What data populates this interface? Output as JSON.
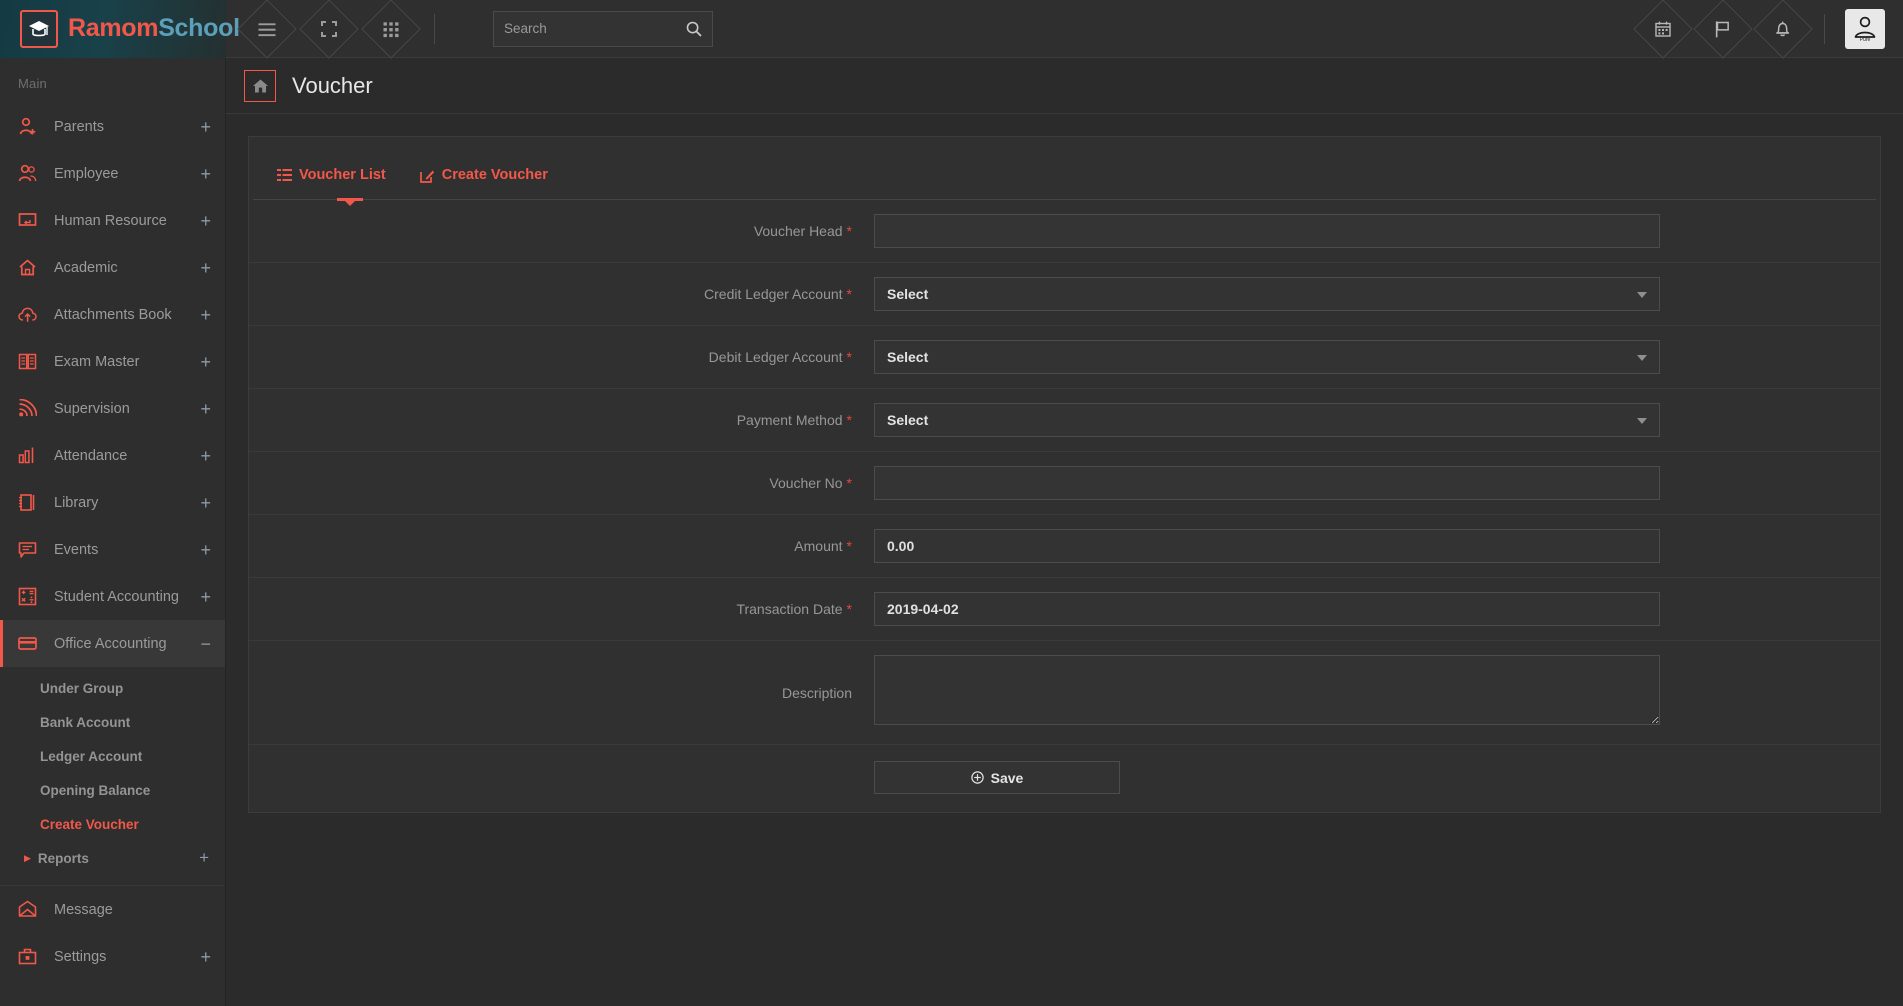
{
  "brand": {
    "name_part1": "Ramom",
    "name_part2": "School",
    "logo_icon": "graduation-cap-icon"
  },
  "topbar": {
    "menu_toggle_icon": "hamburger-menu-icon",
    "fullscreen_icon": "fullscreen-icon",
    "grid_icon": "grid-apps-icon",
    "calendar_icon": "calendar-icon",
    "flag_icon": "flag-icon",
    "bell_icon": "bell-notification-icon",
    "avatar_icon": "user-avatar-icon",
    "avatar_label": "Pure"
  },
  "search": {
    "value": "",
    "placeholder": "Search",
    "icon": "search-icon"
  },
  "sidebar": {
    "heading": "Main",
    "items": [
      {
        "label": "Parents",
        "icon": "user-add-icon",
        "expander": "+"
      },
      {
        "label": "Employee",
        "icon": "users-icon",
        "expander": "+"
      },
      {
        "label": "Human Resource",
        "icon": "monitor-icon",
        "expander": "+"
      },
      {
        "label": "Academic",
        "icon": "home-academic-icon",
        "expander": "+"
      },
      {
        "label": "Attachments Book",
        "icon": "cloud-upload-icon",
        "expander": "+"
      },
      {
        "label": "Exam Master",
        "icon": "open-book-icon",
        "expander": "+"
      },
      {
        "label": "Supervision",
        "icon": "rss-signal-icon",
        "expander": "+"
      },
      {
        "label": "Attendance",
        "icon": "bar-chart-icon",
        "expander": "+"
      },
      {
        "label": "Library",
        "icon": "book-icon",
        "expander": "+"
      },
      {
        "label": "Events",
        "icon": "chat-bubble-icon",
        "expander": "+"
      },
      {
        "label": "Student Accounting",
        "icon": "calculator-icon",
        "expander": "+"
      },
      {
        "label": "Office Accounting",
        "icon": "credit-card-icon",
        "expander": "−",
        "active": true
      }
    ],
    "submenu": [
      {
        "label": "Under Group"
      },
      {
        "label": "Bank Account"
      },
      {
        "label": "Ledger Account"
      },
      {
        "label": "Opening Balance"
      },
      {
        "label": "Create Voucher",
        "active": true
      },
      {
        "label": "Reports",
        "caret": "▶",
        "expander": "+"
      }
    ],
    "bottom_items": [
      {
        "label": "Message",
        "icon": "envelope-icon",
        "expander": ""
      },
      {
        "label": "Settings",
        "icon": "toolbox-icon",
        "expander": "+"
      }
    ]
  },
  "page": {
    "title": "Voucher",
    "home_icon": "home-icon"
  },
  "tabs": [
    {
      "label": "Voucher List",
      "icon": "list-icon",
      "active": false
    },
    {
      "label": "Create Voucher",
      "icon": "pencil-edit-icon",
      "active": true
    }
  ],
  "form": {
    "fields": [
      {
        "label": "Voucher Head",
        "required": true,
        "type": "text",
        "value": "",
        "placeholder": ""
      },
      {
        "label": "Credit Ledger Account",
        "required": true,
        "type": "select",
        "value": "Select"
      },
      {
        "label": "Debit Ledger Account",
        "required": true,
        "type": "select",
        "value": "Select"
      },
      {
        "label": "Payment Method",
        "required": true,
        "type": "select",
        "value": "Select"
      },
      {
        "label": "Voucher No",
        "required": true,
        "type": "text",
        "value": "",
        "placeholder": ""
      },
      {
        "label": "Amount",
        "required": true,
        "type": "text",
        "value": "0.00",
        "placeholder": ""
      },
      {
        "label": "Transaction Date",
        "required": true,
        "type": "text",
        "value": "2019-04-02",
        "placeholder": ""
      },
      {
        "label": "Description",
        "required": false,
        "type": "textarea",
        "value": "",
        "placeholder": ""
      }
    ],
    "required_marker": "*",
    "save_label": "Save",
    "save_icon": "plus-circle-icon"
  },
  "colors": {
    "accent": "#f2584a",
    "brand_blue": "#5c9fb8",
    "required": "#e04a3c",
    "bg": "#2b2b2b",
    "panel": "#303030",
    "sidebar": "#2e2e2e"
  }
}
